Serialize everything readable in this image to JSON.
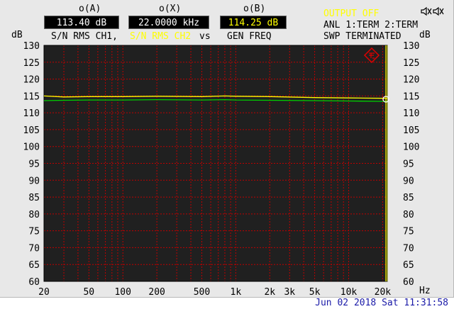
{
  "readouts": [
    {
      "label": "o(A)",
      "value": "113.40 dB",
      "color": "#ffffff"
    },
    {
      "label": "o(X)",
      "value": "22.0000 kHz",
      "color": "#ffffff"
    },
    {
      "label": "o(B)",
      "value": "114.25 dB",
      "color": "#ffff00"
    }
  ],
  "header": {
    "ch1": "S/N RMS CH1,",
    "ch2": "S/N RMS CH2",
    "vs": "vs",
    "gen_freq": "GEN FREQ",
    "output_status": "OUTPUT OFF",
    "anl": "ANL 1:TERM 2:TERM",
    "swp": "SWP TERMINATED",
    "y_unit_left": "dB",
    "y_unit_right": "dB",
    "x_unit": "Hz"
  },
  "datetime": "Jun 02 2018 Sat 11:31:58",
  "colors": {
    "plot_bg": "#202020",
    "grid": "#c00000",
    "ch1": "#00d000",
    "ch2": "#ffff00",
    "accent_yellow": "#ffff00",
    "date_text": "#1a1aa8",
    "logo": "#e00000"
  },
  "icons": {
    "logo": "rs-diamond-logo",
    "status": "speaker-muted-icon"
  },
  "chart_data": {
    "type": "line",
    "xscale": "log",
    "xlim": [
      20,
      22000
    ],
    "ylim": [
      60,
      130
    ],
    "grid": true,
    "y_ticks": [
      60,
      65,
      70,
      75,
      80,
      85,
      90,
      95,
      100,
      105,
      110,
      115,
      120,
      125,
      130
    ],
    "x_ticks": [
      {
        "value": 20,
        "label": "20"
      },
      {
        "value": 50,
        "label": "50"
      },
      {
        "value": 100,
        "label": "100"
      },
      {
        "value": 200,
        "label": "200"
      },
      {
        "value": 500,
        "label": "500"
      },
      {
        "value": 1000,
        "label": "1k"
      },
      {
        "value": 2000,
        "label": "2k"
      },
      {
        "value": 3000,
        "label": "3k"
      },
      {
        "value": 5000,
        "label": "5k"
      },
      {
        "value": 10000,
        "label": "10k"
      },
      {
        "value": 20000,
        "label": "20k"
      }
    ],
    "cursor_x": 22000,
    "x": [
      20,
      30,
      50,
      100,
      200,
      500,
      800,
      1000,
      2000,
      5000,
      10000,
      20000,
      22000
    ],
    "series": [
      {
        "color": "#00d000",
        "values": [
          113.6,
          113.7,
          113.8,
          113.8,
          113.9,
          113.8,
          113.9,
          113.8,
          113.7,
          113.6,
          113.5,
          113.4,
          113.4
        ]
      },
      {
        "color": "#ffff00",
        "values": [
          115.0,
          114.7,
          114.8,
          114.8,
          114.9,
          114.8,
          115.0,
          114.9,
          114.8,
          114.5,
          114.4,
          114.3,
          114.25
        ]
      }
    ]
  }
}
